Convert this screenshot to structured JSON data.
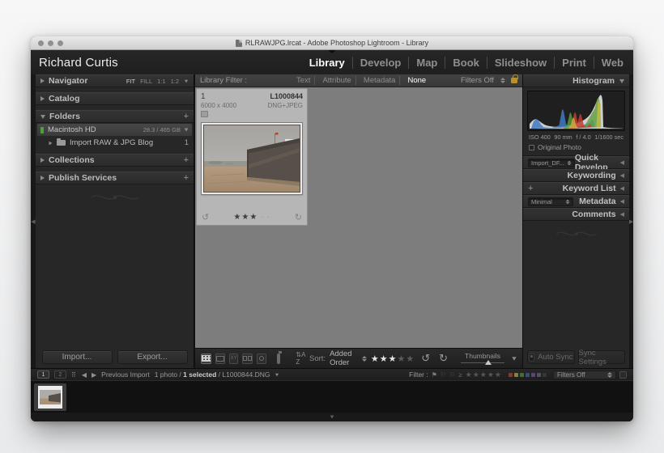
{
  "window": {
    "title": "RLRAWJPG.lrcat - Adobe Photoshop Lightroom - Library"
  },
  "module_bar": {
    "identity": "Richard Curtis",
    "modules": [
      {
        "label": "Library",
        "active": true
      },
      {
        "label": "Develop",
        "active": false
      },
      {
        "label": "Map",
        "active": false
      },
      {
        "label": "Book",
        "active": false
      },
      {
        "label": "Slideshow",
        "active": false
      },
      {
        "label": "Print",
        "active": false
      },
      {
        "label": "Web",
        "active": false
      }
    ]
  },
  "left_panel": {
    "navigator": {
      "title": "Navigator",
      "zooms": [
        "FIT",
        "FILL",
        "1:1",
        "1:2"
      ]
    },
    "catalog": {
      "title": "Catalog"
    },
    "folders": {
      "title": "Folders",
      "add": "+",
      "volume": {
        "name": "Macintosh HD",
        "capacity": "28.3 / 465 GB"
      },
      "items": [
        {
          "name": "Import RAW & JPG Blog",
          "count": "1"
        }
      ]
    },
    "collections": {
      "title": "Collections",
      "add": "+"
    },
    "publish_services": {
      "title": "Publish Services",
      "add": "+"
    },
    "import_button": "Import...",
    "export_button": "Export..."
  },
  "filter_bar": {
    "label": "Library Filter :",
    "options": [
      "Text",
      "Attribute",
      "Metadata",
      "None"
    ],
    "active_option": "None",
    "preset": "Filters Off"
  },
  "grid_cell": {
    "index": "1",
    "filename": "L1000844",
    "dimensions": "6000 x 4000",
    "format": "DNG+JPEG",
    "stars": "★★★",
    "stars_rest": "· ·"
  },
  "toolbar": {
    "sort_label": "Sort:",
    "sort_value": "Added Order",
    "sort_glyph": "A Z",
    "stars_filled": "★★★",
    "stars_empty": "★★",
    "thumbnails_label": "Thumbnails"
  },
  "right_panel": {
    "histogram": {
      "title": "Histogram",
      "iso": "ISO 400",
      "focal_length": "90 mm",
      "aperture": "f / 4.0",
      "shutter": "1/1600 sec",
      "original_photo": "Original Photo"
    },
    "quick_develop": {
      "label": "Quick Develop",
      "preset": "Import_DF..."
    },
    "keywording": {
      "label": "Keywording"
    },
    "keyword_list": {
      "label": "Keyword List",
      "add": "+"
    },
    "metadata": {
      "label": "Metadata",
      "preset": "Minimal"
    },
    "comments": {
      "label": "Comments"
    },
    "auto_sync": "Auto Sync",
    "sync_settings": "Sync Settings"
  },
  "filmstrip": {
    "window1": "1",
    "window2": "2",
    "source": "Previous Import",
    "count": "1 photo /",
    "selected": "1 selected",
    "filename": "/ L1000844.DNG",
    "filter_label": "Filter :",
    "ge": "≥",
    "stars": "★★★★★",
    "preset": "Filters Off",
    "label_colors": [
      "#a03a2e",
      "#b08a2e",
      "#4a7a34",
      "#35568f",
      "#6a4790",
      "#5a5a5a",
      "#3a3a3a"
    ]
  }
}
